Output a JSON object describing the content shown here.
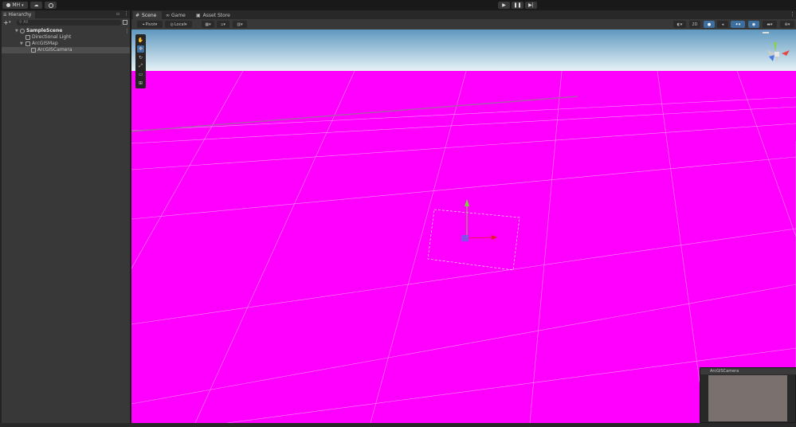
{
  "topbar": {
    "account_label": "MH",
    "account_icon": "user-icon",
    "cloud_icon": "cloud-icon",
    "history_icon": "history-icon",
    "play_icon": "play-icon",
    "pause_icon": "pause-icon",
    "step_icon": "step-icon"
  },
  "hierarchy": {
    "tab_label": "Hierarchy",
    "search_placeholder": "All",
    "items": [
      {
        "label": "SampleScene",
        "kind": "scene"
      },
      {
        "label": "Directional Light",
        "kind": "object"
      },
      {
        "label": "ArcGISMap",
        "kind": "object"
      },
      {
        "label": "ArcGISCamera",
        "kind": "object",
        "selected": true
      }
    ]
  },
  "scene_panel": {
    "tabs": [
      {
        "label": "Scene",
        "icon": "hash-icon",
        "active": true
      },
      {
        "label": "Game",
        "icon": "gamepad-icon",
        "active": false
      },
      {
        "label": "Asset Store",
        "icon": "store-icon",
        "active": false
      }
    ],
    "toolbar": {
      "pivot_label": "Pivot",
      "local_label": "Local",
      "twod_label": "2D"
    },
    "tools": [
      "hand-tool-icon",
      "move-tool-icon",
      "rotate-tool-icon",
      "scale-tool-icon",
      "rect-tool-icon",
      "transform-tool-icon"
    ],
    "colors": {
      "ground": "#ff00ff",
      "sky_top": "#5f98bf",
      "sky_horizon": "#e8f1f4"
    }
  },
  "camera_preview": {
    "title": "ArcGISCamera"
  }
}
